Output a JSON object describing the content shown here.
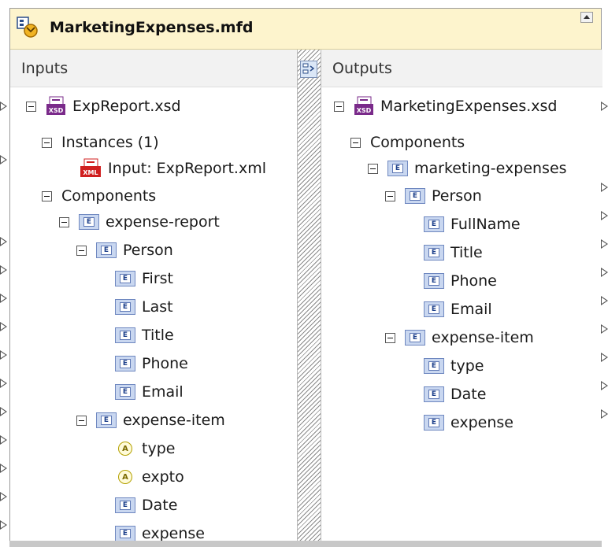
{
  "component": {
    "title": "MarketingExpenses.mfd"
  },
  "inputs": {
    "header": "Inputs",
    "schema": "ExpReport.xsd",
    "instances_label": "Instances (1)",
    "instance_file": "Input: ExpReport.xml",
    "components_label": "Components",
    "root": "expense-report",
    "person": "Person",
    "person_fields": [
      "First",
      "Last",
      "Title",
      "Phone",
      "Email"
    ],
    "item": "expense-item",
    "item_attrs": [
      "type",
      "expto"
    ],
    "item_fields": [
      "Date",
      "expense"
    ]
  },
  "outputs": {
    "header": "Outputs",
    "schema": "MarketingExpenses.xsd",
    "components_label": "Components",
    "root": "marketing-expenses",
    "person": "Person",
    "person_fields": [
      "FullName",
      "Title",
      "Phone",
      "Email"
    ],
    "item": "expense-item",
    "item_fields": [
      "type",
      "Date",
      "expense"
    ]
  },
  "icons": {
    "element_letter": "E",
    "attribute_letter": "A",
    "xsd_badge": "XSD",
    "xml_badge": "XML"
  },
  "colors": {
    "title_bg": "#fdf4cd",
    "element_icon": "#c9d7f0",
    "attribute_icon": "#b3a000",
    "xsd_icon": "#7a2a8a",
    "xml_icon": "#d01f1f"
  }
}
